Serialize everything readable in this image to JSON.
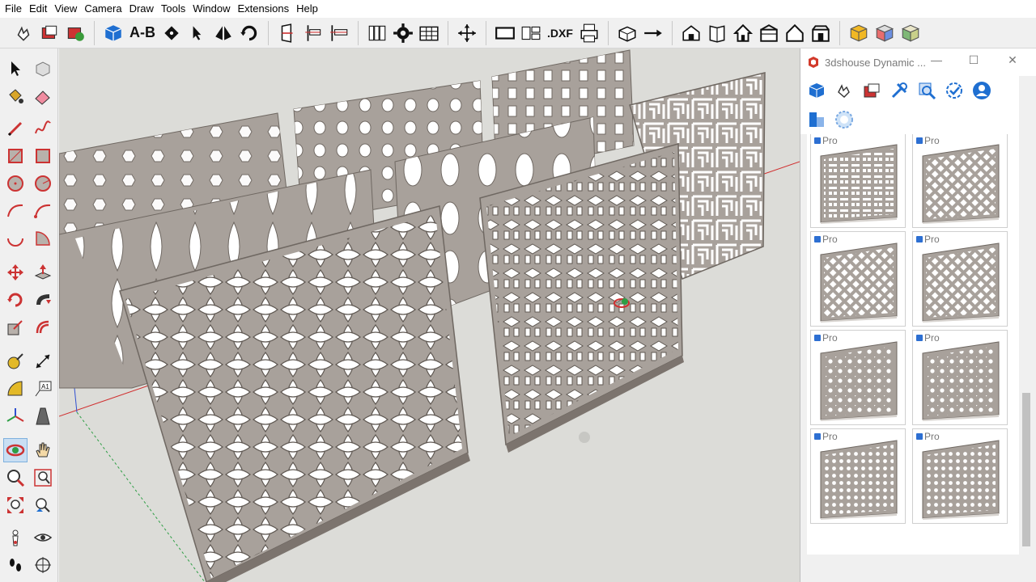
{
  "menu": [
    "File",
    "Edit",
    "View",
    "Camera",
    "Draw",
    "Tools",
    "Window",
    "Extensions",
    "Help"
  ],
  "toolbar": {
    "ab_label": "A-B",
    "dxf_label": ".DXF"
  },
  "left_palette_text": "A1",
  "panel": {
    "title": "3dshouse Dynamic ...",
    "min_icon": "—",
    "max_icon": "☐",
    "close_icon": "✕"
  },
  "cards": [
    {
      "badge": "Pro",
      "pattern": "fret"
    },
    {
      "badge": "Pro",
      "pattern": "lattice"
    },
    {
      "badge": "Pro",
      "pattern": "lattice"
    },
    {
      "badge": "Pro",
      "pattern": "lattice"
    },
    {
      "badge": "Pro",
      "pattern": "dots"
    },
    {
      "badge": "Pro",
      "pattern": "dots"
    },
    {
      "badge": "Pro",
      "pattern": "circles"
    },
    {
      "badge": "Pro",
      "pattern": "circles"
    }
  ],
  "colors": {
    "viewport_bg": "#dcdcd8",
    "panel_face": "#a8a19b",
    "panel_edge": "#6f6862",
    "accent_blue": "#1f6fd1",
    "axis_red": "#d03030",
    "axis_green": "#2e9e45",
    "axis_blue": "#3050d0"
  }
}
